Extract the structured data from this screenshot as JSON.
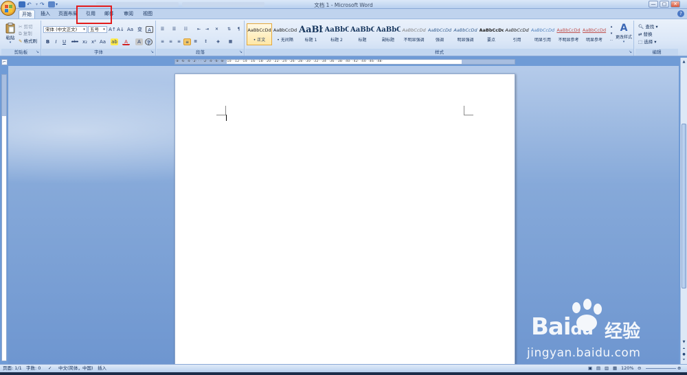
{
  "window": {
    "title": "文档 1 - Microsoft Word",
    "controls": [
      "—",
      "▢",
      "✕"
    ]
  },
  "tabs": [
    {
      "label": "开始",
      "active": true
    },
    {
      "label": "插入",
      "active": false
    },
    {
      "label": "页面布局",
      "active": false
    },
    {
      "label": "引用",
      "active": false
    },
    {
      "label": "邮件",
      "active": false
    },
    {
      "label": "审阅",
      "active": false
    },
    {
      "label": "视图",
      "active": false
    }
  ],
  "clipboard": {
    "paste": "粘贴",
    "cut": "剪切",
    "copy": "复制",
    "format_painter": "格式刷",
    "group_label": "剪贴板"
  },
  "font": {
    "font_name": "宋体 (中文正文)",
    "font_size": "五号",
    "group_label": "字体",
    "row1_buttons": [
      "A↑",
      "A↓",
      "Aa",
      "变",
      "A"
    ],
    "row2_buttons": [
      "B",
      "I",
      "U",
      "abc",
      "x₂",
      "x²",
      "Aa",
      "ab",
      "A",
      "A",
      "字"
    ]
  },
  "paragraph": {
    "group_label": "段落"
  },
  "styles": {
    "group_label": "样式",
    "items": [
      {
        "preview": "AaBbCcDd",
        "name": "• 正文",
        "selected": true
      },
      {
        "preview": "AaBbCcDd",
        "name": "• 无间隔",
        "selected": false
      },
      {
        "preview": "AaBb",
        "name": "标题 1",
        "selected": false
      },
      {
        "preview": "AaBbC",
        "name": "标题 2",
        "selected": false
      },
      {
        "preview": "AaBbC",
        "name": "标题",
        "selected": false
      },
      {
        "preview": "AaBbC",
        "name": "副标题",
        "selected": false
      },
      {
        "preview": "AaBbCcDd",
        "name": "不明显强调",
        "selected": false
      },
      {
        "preview": "AaBbCcDd",
        "name": "强调",
        "selected": false
      },
      {
        "preview": "AaBbCcDd",
        "name": "明显强调",
        "selected": false
      },
      {
        "preview": "AaBbCcDd",
        "name": "要点",
        "selected": false
      },
      {
        "preview": "AaBbCcDd",
        "name": "引用",
        "selected": false
      },
      {
        "preview": "AaBbCcDd",
        "name": "明显引用",
        "selected": false
      },
      {
        "preview": "AaBbCcDd",
        "name": "不明显参考",
        "selected": false
      },
      {
        "preview": "AaBbCcDd",
        "name": "明显参考",
        "selected": false
      }
    ],
    "change_styles": "更改样式"
  },
  "editing": {
    "group_label": "编辑",
    "find": "查找",
    "replace": "替换",
    "select": "选择"
  },
  "ruler": {
    "ticks": "·8· ·6· ·4· ·2· · · ·2· ·4· ·6· ·8· ·10· ·12· ·14· ·16· ·18· ·20· ·22· ·24· ·26· ·28· ·30· ·32· ·34· ·36· ·38· ·40· ·42· ·44· ·46· ·48·"
  },
  "statusbar": {
    "page": "页面: 1/1",
    "words": "字数: 0",
    "language": "中文(简体，中国)",
    "mode": "插入",
    "zoom": "120%"
  },
  "watermark": {
    "brand": "Bai",
    "brand_accent": "du",
    "jingyan": "经验",
    "url": "jingyan.baidu.com"
  },
  "colors": {
    "highlight": "#e31b1b",
    "ribbon": "#dbe7f7",
    "doc_background": "#86a9d9"
  }
}
